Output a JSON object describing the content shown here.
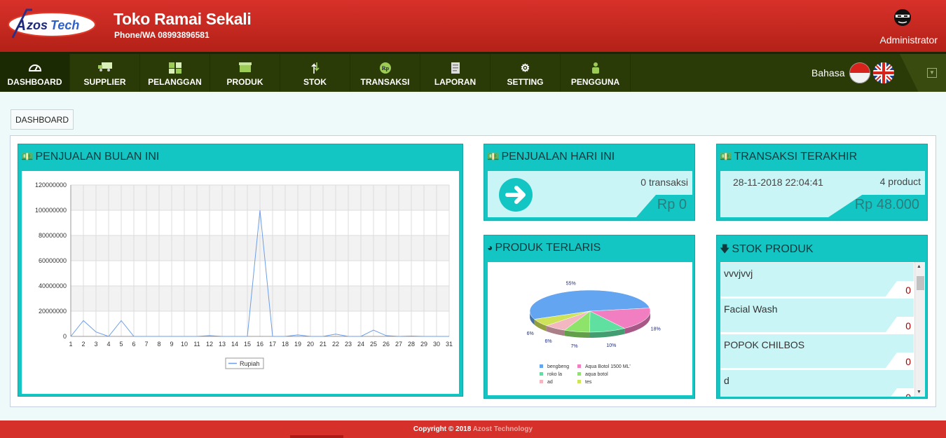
{
  "header": {
    "logo_text": "AzosTech",
    "shop_name": "Toko Ramai Sekali",
    "phone": "Phone/WA 08993896581",
    "user_name": "Administrator"
  },
  "nav": {
    "items": [
      {
        "label": "DASHBOARD",
        "icon": "gauge-icon",
        "active": true
      },
      {
        "label": "SUPPLIER",
        "icon": "truck-icon"
      },
      {
        "label": "PELANGGAN",
        "icon": "customers-icon"
      },
      {
        "label": "PRODUK",
        "icon": "box-icon"
      },
      {
        "label": "STOK",
        "icon": "stock-arrows-icon"
      },
      {
        "label": "TRANSAKSI",
        "icon": "rupiah-coin-icon"
      },
      {
        "label": "LAPORAN",
        "icon": "report-icon"
      },
      {
        "label": "SETTING",
        "icon": "gear-icon"
      },
      {
        "label": "PENGGUNA",
        "icon": "user-icon"
      }
    ],
    "language_label": "Bahasa"
  },
  "breadcrumb": "DASHBOARD",
  "panels": {
    "monthly_sales": {
      "title": "PENJUALAN BULAN INI"
    },
    "today_sales": {
      "title": "PENJUALAN HARI INI",
      "transactions": "0 transaksi",
      "amount": "Rp 0"
    },
    "last_transaction": {
      "title": "TRANSAKSI TERAKHIR",
      "datetime": "28-11-2018 22:04:41",
      "products": "4 product",
      "amount": "Rp 48.000"
    },
    "best_products": {
      "title": "PRODUK TERLARIS"
    },
    "stock": {
      "title": "STOK PRODUK",
      "items": [
        {
          "name": "vvvjvvj",
          "qty": "0"
        },
        {
          "name": "Facial Wash",
          "qty": "0"
        },
        {
          "name": "POPOK CHILBOS",
          "qty": "0"
        },
        {
          "name": "d",
          "qty": "0"
        }
      ]
    }
  },
  "colors": {
    "accent": "#13c6c4",
    "header": "#c72a22",
    "nav": "#2b3b07",
    "line": "#6d9ee6"
  },
  "chart_data": [
    {
      "type": "line",
      "x": [
        1,
        2,
        3,
        4,
        5,
        6,
        7,
        8,
        9,
        10,
        11,
        12,
        13,
        14,
        15,
        16,
        17,
        18,
        19,
        20,
        21,
        22,
        23,
        24,
        25,
        26,
        27,
        28,
        29,
        30,
        31
      ],
      "series": [
        {
          "name": "Rupiah",
          "values": [
            0,
            12500000,
            3500000,
            0,
            12500000,
            0,
            0,
            0,
            0,
            0,
            0,
            600000,
            0,
            0,
            0,
            100000000,
            0,
            0,
            1200000,
            0,
            0,
            1800000,
            0,
            0,
            5000000,
            600000,
            0,
            300000,
            0,
            0,
            0
          ]
        }
      ],
      "ylim": [
        0,
        120000000
      ],
      "yticks": [
        "0",
        "20000000",
        "40000000",
        "60000000",
        "80000000",
        "100000000",
        "120000000"
      ],
      "grid": true,
      "legend": "bottom"
    },
    {
      "type": "pie",
      "labels": [
        "bengbeng",
        "Aqua Botol 1500 ML'",
        "roko la",
        "aqua botol",
        "ad",
        "tes"
      ],
      "values": [
        55,
        18,
        10,
        7,
        6,
        6
      ],
      "value_labels": [
        "55%",
        "18%",
        "10%",
        "7%",
        "6%",
        "6%"
      ],
      "colors": [
        "#63a5f0",
        "#f07ec0",
        "#5fe0a0",
        "#8ee36a",
        "#f3b7c2",
        "#cfe35a"
      ],
      "legend": "bottom"
    }
  ]
}
